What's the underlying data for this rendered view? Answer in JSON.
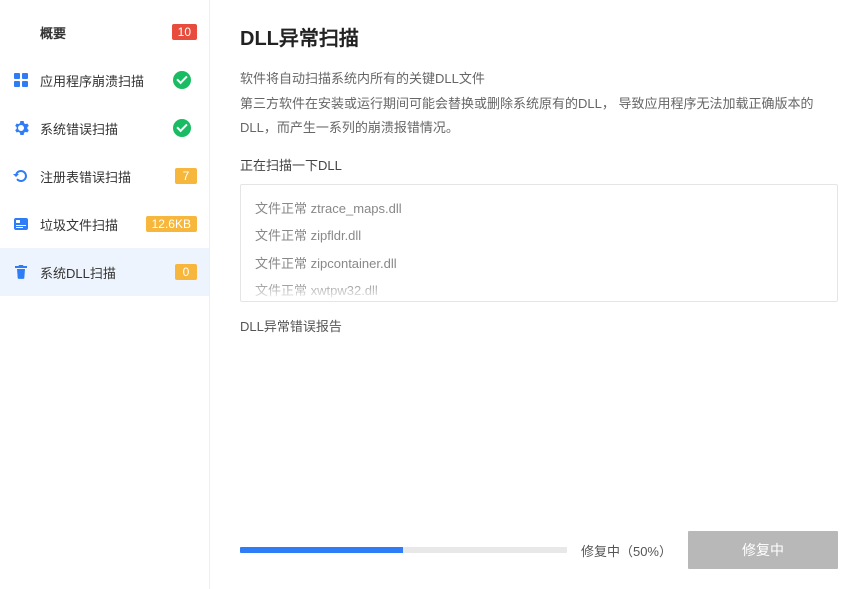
{
  "sidebar": {
    "items": [
      {
        "label": "概要",
        "badge": "10",
        "badgeClass": "badge-red",
        "iconType": "none"
      },
      {
        "label": "应用程序崩溃扫描",
        "badge": "check",
        "iconType": "grid"
      },
      {
        "label": "系统错误扫描",
        "badge": "check",
        "iconType": "gear"
      },
      {
        "label": "注册表错误扫描",
        "badge": "7",
        "badgeClass": "badge-yellow",
        "iconType": "refresh"
      },
      {
        "label": "垃圾文件扫描",
        "badge": "12.6KB",
        "badgeClass": "badge-orange",
        "iconType": "disk"
      },
      {
        "label": "系统DLL扫描",
        "badge": "0",
        "badgeClass": "badge-yellow",
        "iconType": "trash",
        "active": true
      }
    ]
  },
  "main": {
    "title": "DLL异常扫描",
    "desc1": "软件将自动扫描系统内所有的关键DLL文件",
    "desc2": "第三方软件在安装或运行期间可能会替换或删除系统原有的DLL， 导致应用程序无法加载正确版本的DLL，而产生一系列的崩溃报错情况。",
    "scanStatus": "正在扫描一下DLL",
    "scanRows": [
      "文件正常 ztrace_maps.dll",
      "文件正常 zipfldr.dll",
      "文件正常 zipcontainer.dll",
      "文件正常 xwtpw32.dll"
    ],
    "reportTitle": "DLL异常错误报告"
  },
  "footer": {
    "progressPercent": 50,
    "progressText": "修复中（50%）",
    "buttonLabel": "修复中"
  }
}
